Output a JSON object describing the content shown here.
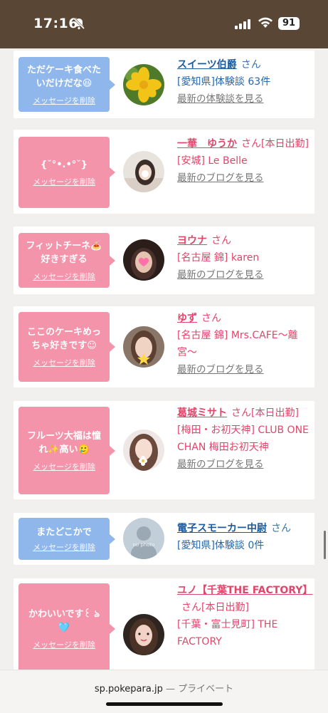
{
  "status_bar": {
    "time": "17:16",
    "battery": "91"
  },
  "cards": [
    {
      "message": "ただケーキ食べたいだけだな😆",
      "delete": "メッセージを削除",
      "name": "スイーツ伯爵",
      "san": "さん",
      "tag": "",
      "details": [
        "[愛知県]体験談 63件"
      ],
      "more": "最新の体験談を見る",
      "bubble_color": "#8fb7ec"
    },
    {
      "message": "{˘°•.•°˘}",
      "delete": "メッセージを削除",
      "name": "一華　ゆうか",
      "san": "さん",
      "tag": "[本日出勤]",
      "details": [
        "[安城] Le Belle"
      ],
      "more": "最新のブログを見る",
      "bubble_color": "#f494aa"
    },
    {
      "message": "フィットチーネ🍝好きすぎる",
      "delete": "メッセージを削除",
      "name": "ヨウナ",
      "san": "さん",
      "tag": "",
      "details": [
        "[名古屋 錦] karen"
      ],
      "more": "最新のブログを見る",
      "bubble_color": "#f494aa"
    },
    {
      "message": "ここのケーキめっちゃ好きです☺︎",
      "delete": "メッセージを削除",
      "name": "ゆず",
      "san": "さん",
      "tag": "",
      "details": [
        "[名古屋 錦] Mrs.CAFE〜離宮〜"
      ],
      "more": "最新のブログを見る",
      "bubble_color": "#f494aa"
    },
    {
      "message": "フルーツ大福は憧れ✨高い🥲",
      "delete": "メッセージを削除",
      "name": "葛城ミサト",
      "san": "さん",
      "tag": "[本日出勤]",
      "details": [
        "[梅田・お初天神] CLUB ONE CHAN 梅田お初天神"
      ],
      "more": "最新のブログを見る",
      "bubble_color": "#f494aa"
    },
    {
      "message": "またどこかで",
      "delete": "メッセージを削除",
      "name": "電子スモーカー中尉",
      "san": "さん",
      "tag": "",
      "details": [
        "[愛知県]体験談 0件"
      ],
      "more": "",
      "bubble_color": "#8fb7ec",
      "avatar_text": "no photo"
    },
    {
      "message": "かわいいです꒰ ঌ🩵",
      "delete": "メッセージを削除",
      "name": "ユノ【千葉THE FACTORY】",
      "san": "さん",
      "tag": "[本日出勤]",
      "details": [
        "[千葉・富士見町] THE FACTORY"
      ],
      "more": "",
      "bubble_color": "#f494aa"
    }
  ],
  "bottom_bar": {
    "domain": "sp.pokepara.jp",
    "mode": "— プライベート"
  }
}
